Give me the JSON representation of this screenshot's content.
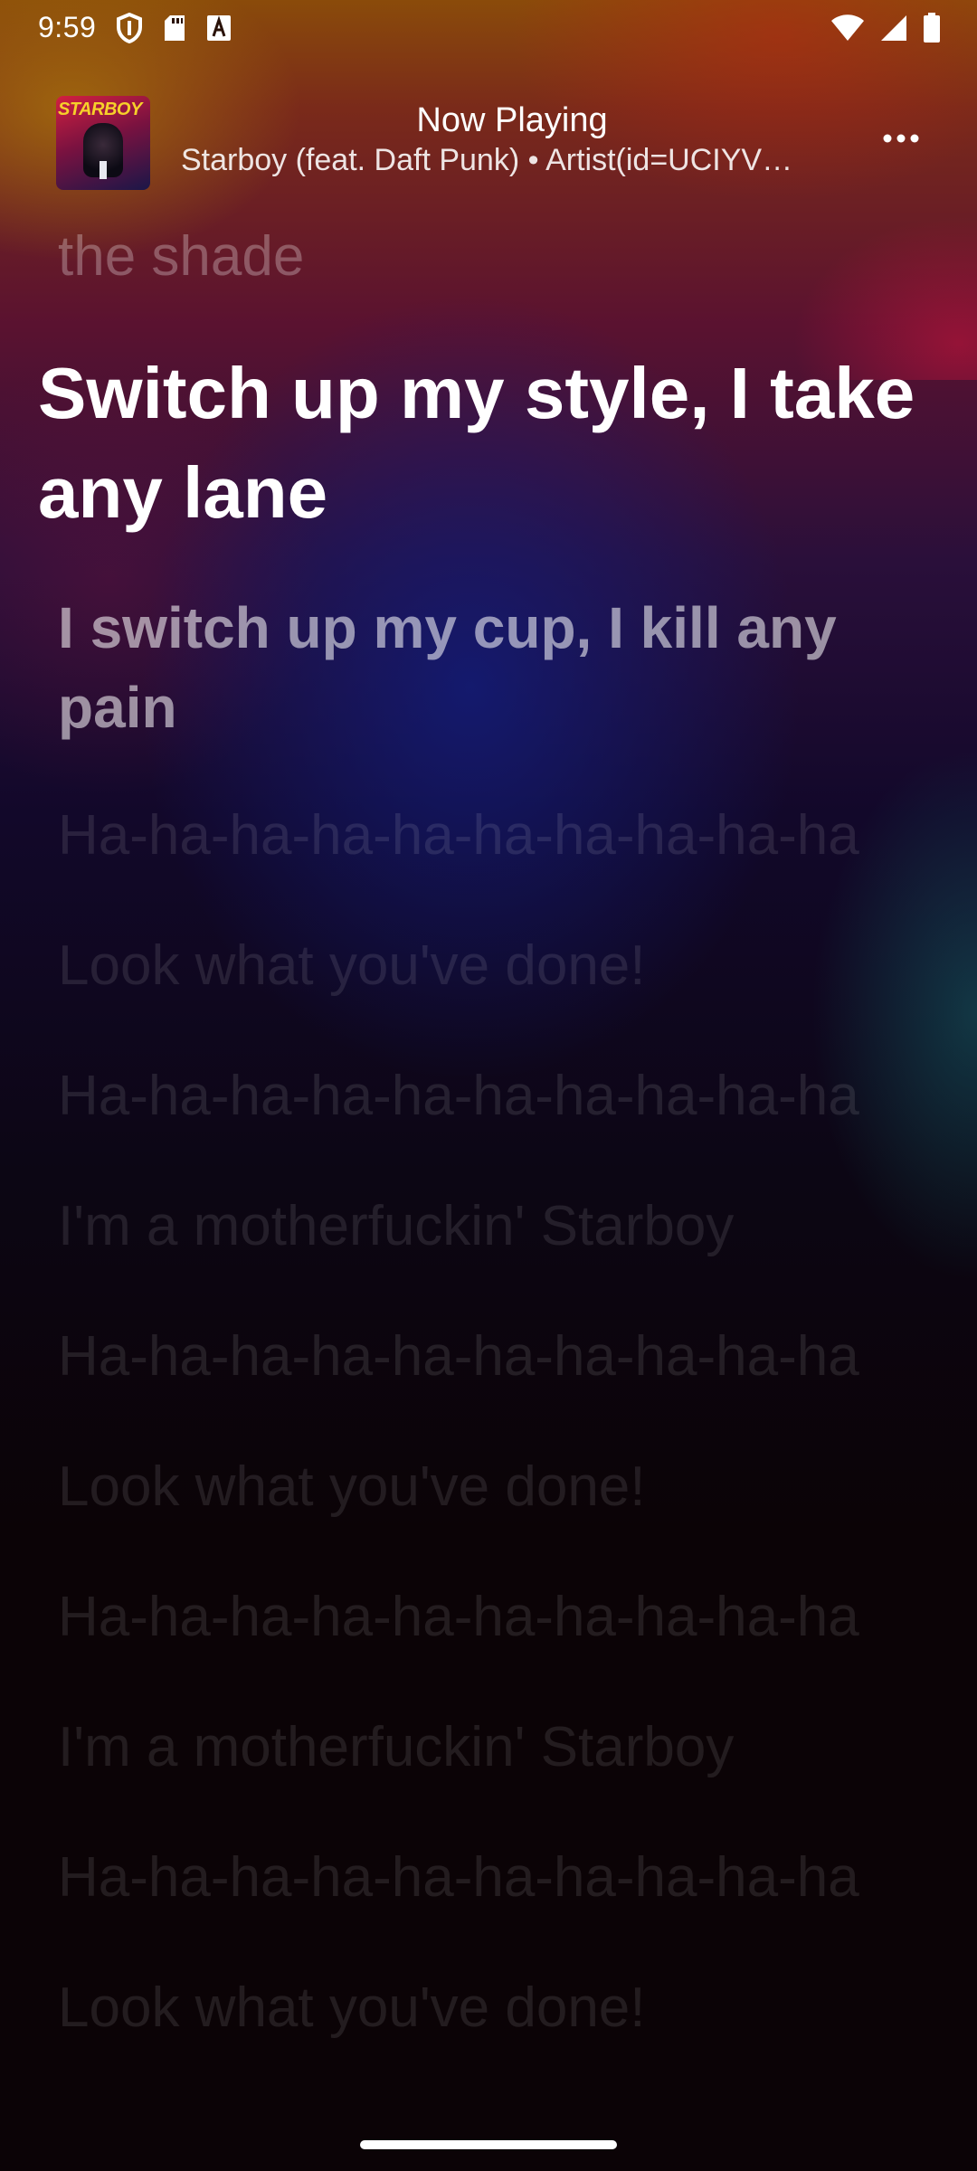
{
  "status_bar": {
    "time": "9:59",
    "left_icons": [
      "shield-icon",
      "sd-card-icon",
      "font-a-icon"
    ],
    "right_icons": [
      "wifi-icon",
      "cellular-signal-icon",
      "battery-icon"
    ]
  },
  "header": {
    "title": "Now Playing",
    "subtitle": "Starboy (feat. Daft Punk) • Artist(id=UCIYV…",
    "album_art_text": "STARBOY",
    "menu_icon": "more-horizontal-icon"
  },
  "lyrics": {
    "previous": "the shade",
    "current": "Switch up my style, I take any lane",
    "next": "I switch up my cup, I kill any pain",
    "upcoming": [
      "Ha-ha-ha-ha-ha-ha-ha-ha-ha-ha",
      "Look what you've done!",
      "Ha-ha-ha-ha-ha-ha-ha-ha-ha-ha",
      "I'm a motherfuckin' Starboy",
      "Ha-ha-ha-ha-ha-ha-ha-ha-ha-ha",
      "Look what you've done!",
      "Ha-ha-ha-ha-ha-ha-ha-ha-ha-ha",
      "I'm a motherfuckin' Starboy",
      "Ha-ha-ha-ha-ha-ha-ha-ha-ha-ha",
      "Look what you've done!"
    ]
  },
  "colors": {
    "text": "#ffffff",
    "background_dark": "#0b0306"
  }
}
